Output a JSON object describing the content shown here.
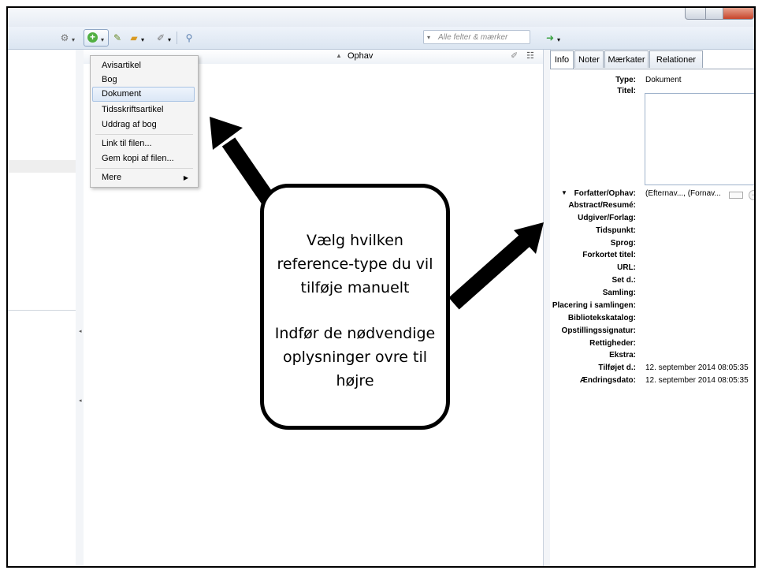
{
  "toolbar": {
    "new_item_icon": "plus-circle-icon",
    "search_placeholder": "Alle felter & mærker"
  },
  "items_list": {
    "column_header": "Ophav"
  },
  "new_item_menu": {
    "items": [
      "Avisartikel",
      "Bog",
      "Dokument",
      "Tidsskriftsartikel",
      "Uddrag af bog"
    ],
    "highlighted": "Dokument",
    "file_items": [
      "Link til filen...",
      "Gem kopi af filen..."
    ],
    "more": "Mere"
  },
  "item_pane": {
    "tabs": [
      "Info",
      "Noter",
      "Mærkater",
      "Relationer"
    ],
    "active_tab": "Info",
    "type_label": "Type:",
    "type_value": "Dokument",
    "title_label": "Titel:",
    "creator_label": "Forfatter/Ophav:",
    "creator_value": "(Efternav..., (Fornav...",
    "fields": [
      "Abstract/Resumé:",
      "Udgiver/Forlag:",
      "Tidspunkt:",
      "Sprog:",
      "Forkortet titel:",
      "URL:",
      "Set d.:",
      "Samling:",
      "Placering i samlingen:",
      "Bibliotekskatalog:",
      "Opstillingssignatur:",
      "Rettigheder:",
      "Ekstra:"
    ],
    "added_label": "Tilføjet d.:",
    "added_value": "12. september 2014 08:05:35",
    "modified_label": "Ændringsdato:",
    "modified_value": "12. september 2014 08:05:35"
  },
  "callout": {
    "line1": "Vælg hvilken",
    "line2": "reference-type du vil",
    "line3": "tilføje manuelt",
    "line4": "Indfør de nødvendige",
    "line5": "oplysninger ovre til",
    "line6": "højre"
  }
}
